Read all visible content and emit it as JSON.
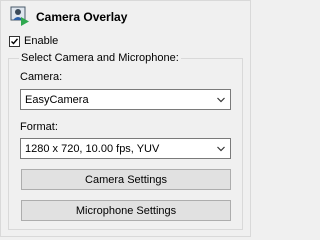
{
  "window": {
    "title": "Camera Overlay",
    "icon": "camera-overlay-icon"
  },
  "enable": {
    "label": "Enable",
    "checked": true
  },
  "group": {
    "legend": "Select Camera and Microphone:",
    "camera_label": "Camera:",
    "camera_value": "EasyCamera",
    "format_label": "Format:",
    "format_value": "1280 x 720, 10.00 fps, YUV",
    "camera_settings_label": "Camera Settings",
    "microphone_settings_label": "Microphone Settings"
  },
  "colors": {
    "background": "#f0f0f0",
    "accent_green": "#2fa84f",
    "icon_blue": "#2b5fa8"
  }
}
